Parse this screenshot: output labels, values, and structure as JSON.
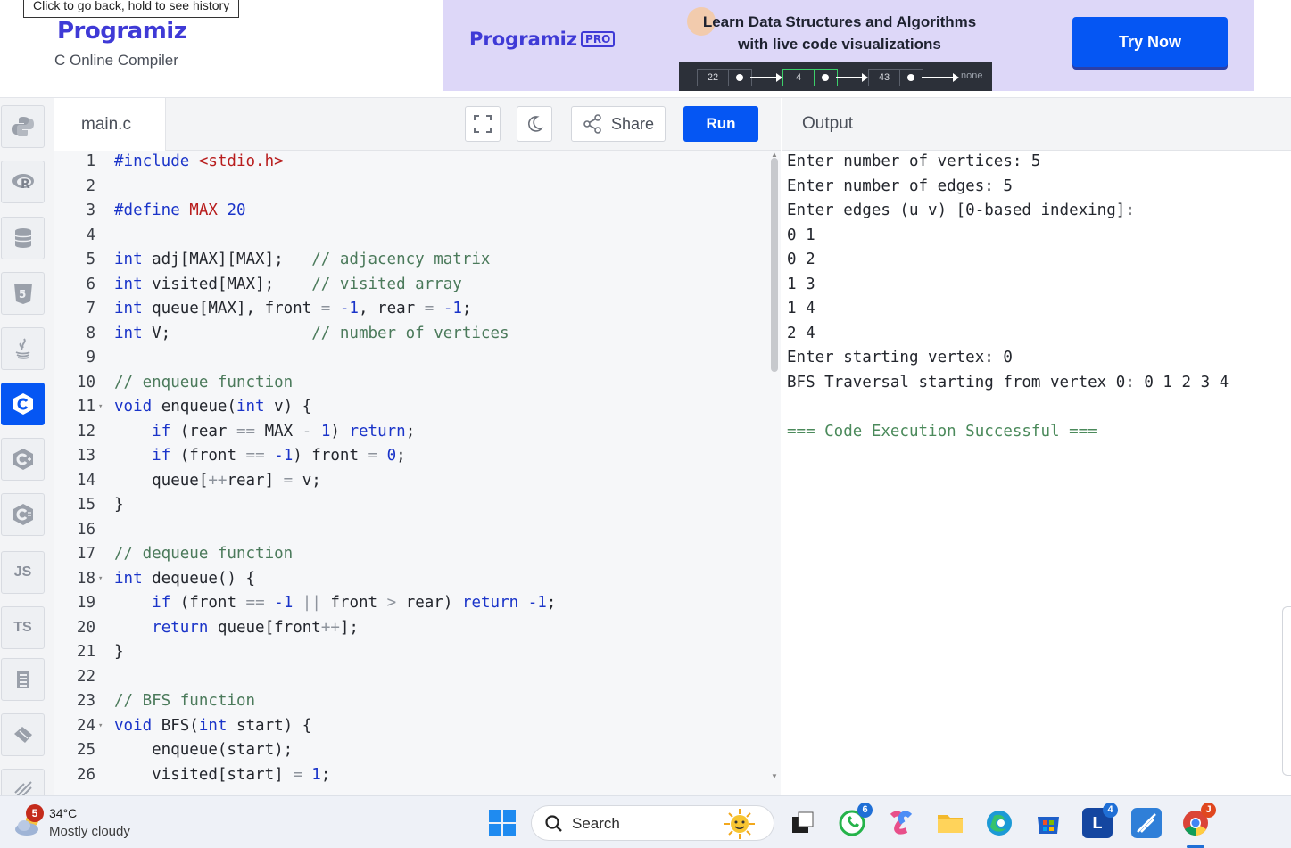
{
  "browser": {
    "tooltip": "Click to go back, hold to see history"
  },
  "header": {
    "logo": "Programiz",
    "subtitle": "C Online Compiler"
  },
  "ad": {
    "logo": "Programiz",
    "badge": "PRO",
    "headline_1": "Learn Data Structures and Algorithms",
    "headline_2": "with live code visualizations",
    "nodes": [
      "22",
      "4",
      "43"
    ],
    "tail": "none",
    "cta": "Try Now"
  },
  "sidebar": {
    "items": [
      {
        "name": "python-icon",
        "label": ""
      },
      {
        "name": "r-icon",
        "label": "R"
      },
      {
        "name": "sql-icon",
        "label": ""
      },
      {
        "name": "html-icon",
        "label": "5"
      },
      {
        "name": "java-icon",
        "label": ""
      },
      {
        "name": "c-icon",
        "label": "C"
      },
      {
        "name": "cpp-icon",
        "label": "C"
      },
      {
        "name": "csharp-icon",
        "label": "C"
      },
      {
        "name": "js-icon",
        "label": "JS"
      },
      {
        "name": "ts-icon",
        "label": "TS"
      },
      {
        "name": "go-icon",
        "label": ""
      },
      {
        "name": "php-icon",
        "label": ""
      },
      {
        "name": "swift-icon",
        "label": ""
      }
    ],
    "active": "c-icon"
  },
  "editor": {
    "filename": "main.c",
    "share_label": "Share",
    "run_label": "Run",
    "lines": [
      {
        "n": "1",
        "fold": ""
      },
      {
        "n": "2",
        "fold": ""
      },
      {
        "n": "3",
        "fold": ""
      },
      {
        "n": "4",
        "fold": ""
      },
      {
        "n": "5",
        "fold": ""
      },
      {
        "n": "6",
        "fold": ""
      },
      {
        "n": "7",
        "fold": ""
      },
      {
        "n": "8",
        "fold": ""
      },
      {
        "n": "9",
        "fold": ""
      },
      {
        "n": "10",
        "fold": ""
      },
      {
        "n": "11",
        "fold": "▾"
      },
      {
        "n": "12",
        "fold": ""
      },
      {
        "n": "13",
        "fold": ""
      },
      {
        "n": "14",
        "fold": ""
      },
      {
        "n": "15",
        "fold": ""
      },
      {
        "n": "16",
        "fold": ""
      },
      {
        "n": "17",
        "fold": ""
      },
      {
        "n": "18",
        "fold": "▾"
      },
      {
        "n": "19",
        "fold": ""
      },
      {
        "n": "20",
        "fold": ""
      },
      {
        "n": "21",
        "fold": ""
      },
      {
        "n": "22",
        "fold": ""
      },
      {
        "n": "23",
        "fold": ""
      },
      {
        "n": "24",
        "fold": "▾"
      },
      {
        "n": "25",
        "fold": ""
      },
      {
        "n": "26",
        "fold": ""
      }
    ],
    "code": [
      [
        [
          "pp",
          "#include "
        ],
        [
          "str",
          "<stdio.h>"
        ]
      ],
      [],
      [
        [
          "pp",
          "#define "
        ],
        [
          "str",
          "MAX "
        ],
        [
          "num",
          "20"
        ]
      ],
      [],
      [
        [
          "kw",
          "int"
        ],
        [
          "t",
          " adj[MAX][MAX];   "
        ],
        [
          "cm",
          "// adjacency matrix"
        ]
      ],
      [
        [
          "kw",
          "int"
        ],
        [
          "t",
          " visited[MAX];    "
        ],
        [
          "cm",
          "// visited array"
        ]
      ],
      [
        [
          "kw",
          "int"
        ],
        [
          "t",
          " queue[MAX], front "
        ],
        [
          "op",
          "="
        ],
        [
          "t",
          " "
        ],
        [
          "num",
          "-1"
        ],
        [
          "t",
          ", rear "
        ],
        [
          "op",
          "="
        ],
        [
          "t",
          " "
        ],
        [
          "num",
          "-1"
        ],
        [
          "t",
          ";"
        ]
      ],
      [
        [
          "kw",
          "int"
        ],
        [
          "t",
          " V;               "
        ],
        [
          "cm",
          "// number of vertices"
        ]
      ],
      [],
      [
        [
          "cm",
          "// enqueue function"
        ]
      ],
      [
        [
          "kw",
          "void"
        ],
        [
          "t",
          " enqueue("
        ],
        [
          "kw",
          "int"
        ],
        [
          "t",
          " v) {"
        ]
      ],
      [
        [
          "t",
          "    "
        ],
        [
          "kw",
          "if"
        ],
        [
          "t",
          " (rear "
        ],
        [
          "op",
          "=="
        ],
        [
          "t",
          " MAX "
        ],
        [
          "op",
          "-"
        ],
        [
          "t",
          " "
        ],
        [
          "num",
          "1"
        ],
        [
          "t",
          ") "
        ],
        [
          "kw",
          "return"
        ],
        [
          "t",
          ";"
        ]
      ],
      [
        [
          "t",
          "    "
        ],
        [
          "kw",
          "if"
        ],
        [
          "t",
          " (front "
        ],
        [
          "op",
          "=="
        ],
        [
          "t",
          " "
        ],
        [
          "num",
          "-1"
        ],
        [
          "t",
          ") front "
        ],
        [
          "op",
          "="
        ],
        [
          "t",
          " "
        ],
        [
          "num",
          "0"
        ],
        [
          "t",
          ";"
        ]
      ],
      [
        [
          "t",
          "    queue["
        ],
        [
          "op",
          "++"
        ],
        [
          "t",
          "rear] "
        ],
        [
          "op",
          "="
        ],
        [
          "t",
          " v;"
        ]
      ],
      [
        [
          "t",
          "}"
        ]
      ],
      [],
      [
        [
          "cm",
          "// dequeue function"
        ]
      ],
      [
        [
          "kw",
          "int"
        ],
        [
          "t",
          " dequeue() {"
        ]
      ],
      [
        [
          "t",
          "    "
        ],
        [
          "kw",
          "if"
        ],
        [
          "t",
          " (front "
        ],
        [
          "op",
          "=="
        ],
        [
          "t",
          " "
        ],
        [
          "num",
          "-1"
        ],
        [
          "t",
          " "
        ],
        [
          "op",
          "||"
        ],
        [
          "t",
          " front "
        ],
        [
          "op",
          ">"
        ],
        [
          "t",
          " rear) "
        ],
        [
          "kw",
          "return"
        ],
        [
          "t",
          " "
        ],
        [
          "num",
          "-1"
        ],
        [
          "t",
          ";"
        ]
      ],
      [
        [
          "t",
          "    "
        ],
        [
          "kw",
          "return"
        ],
        [
          "t",
          " queue[front"
        ],
        [
          "op",
          "++"
        ],
        [
          "t",
          "];"
        ]
      ],
      [
        [
          "t",
          "}"
        ]
      ],
      [],
      [
        [
          "cm",
          "// BFS function"
        ]
      ],
      [
        [
          "kw",
          "void"
        ],
        [
          "t",
          " BFS("
        ],
        [
          "kw",
          "int"
        ],
        [
          "t",
          " start) {"
        ]
      ],
      [
        [
          "t",
          "    enqueue(start);"
        ]
      ],
      [
        [
          "t",
          "    visited[start] "
        ],
        [
          "op",
          "="
        ],
        [
          "t",
          " "
        ],
        [
          "num",
          "1"
        ],
        [
          "t",
          ";"
        ]
      ]
    ]
  },
  "output": {
    "title": "Output",
    "lines": [
      "Enter number of vertices: 5",
      "Enter number of edges: 5",
      "Enter edges (u v) [0-based indexing]:",
      "0 1",
      "0 2",
      "1 3",
      "1 4",
      "2 4",
      "Enter starting vertex: 0",
      "BFS Traversal starting from vertex 0: 0 1 2 3 4",
      "",
      "=== Code Execution Successful ==="
    ]
  },
  "taskbar": {
    "weather_badge": "5",
    "temperature": "34°C",
    "condition": "Mostly cloudy",
    "search_label": "Search",
    "whatsapp_badge": "6",
    "l_badge": "4"
  },
  "colors": {
    "brand": "#3f3ad6",
    "primary": "#0556f3",
    "banner_bg": "#ddd7f8"
  }
}
